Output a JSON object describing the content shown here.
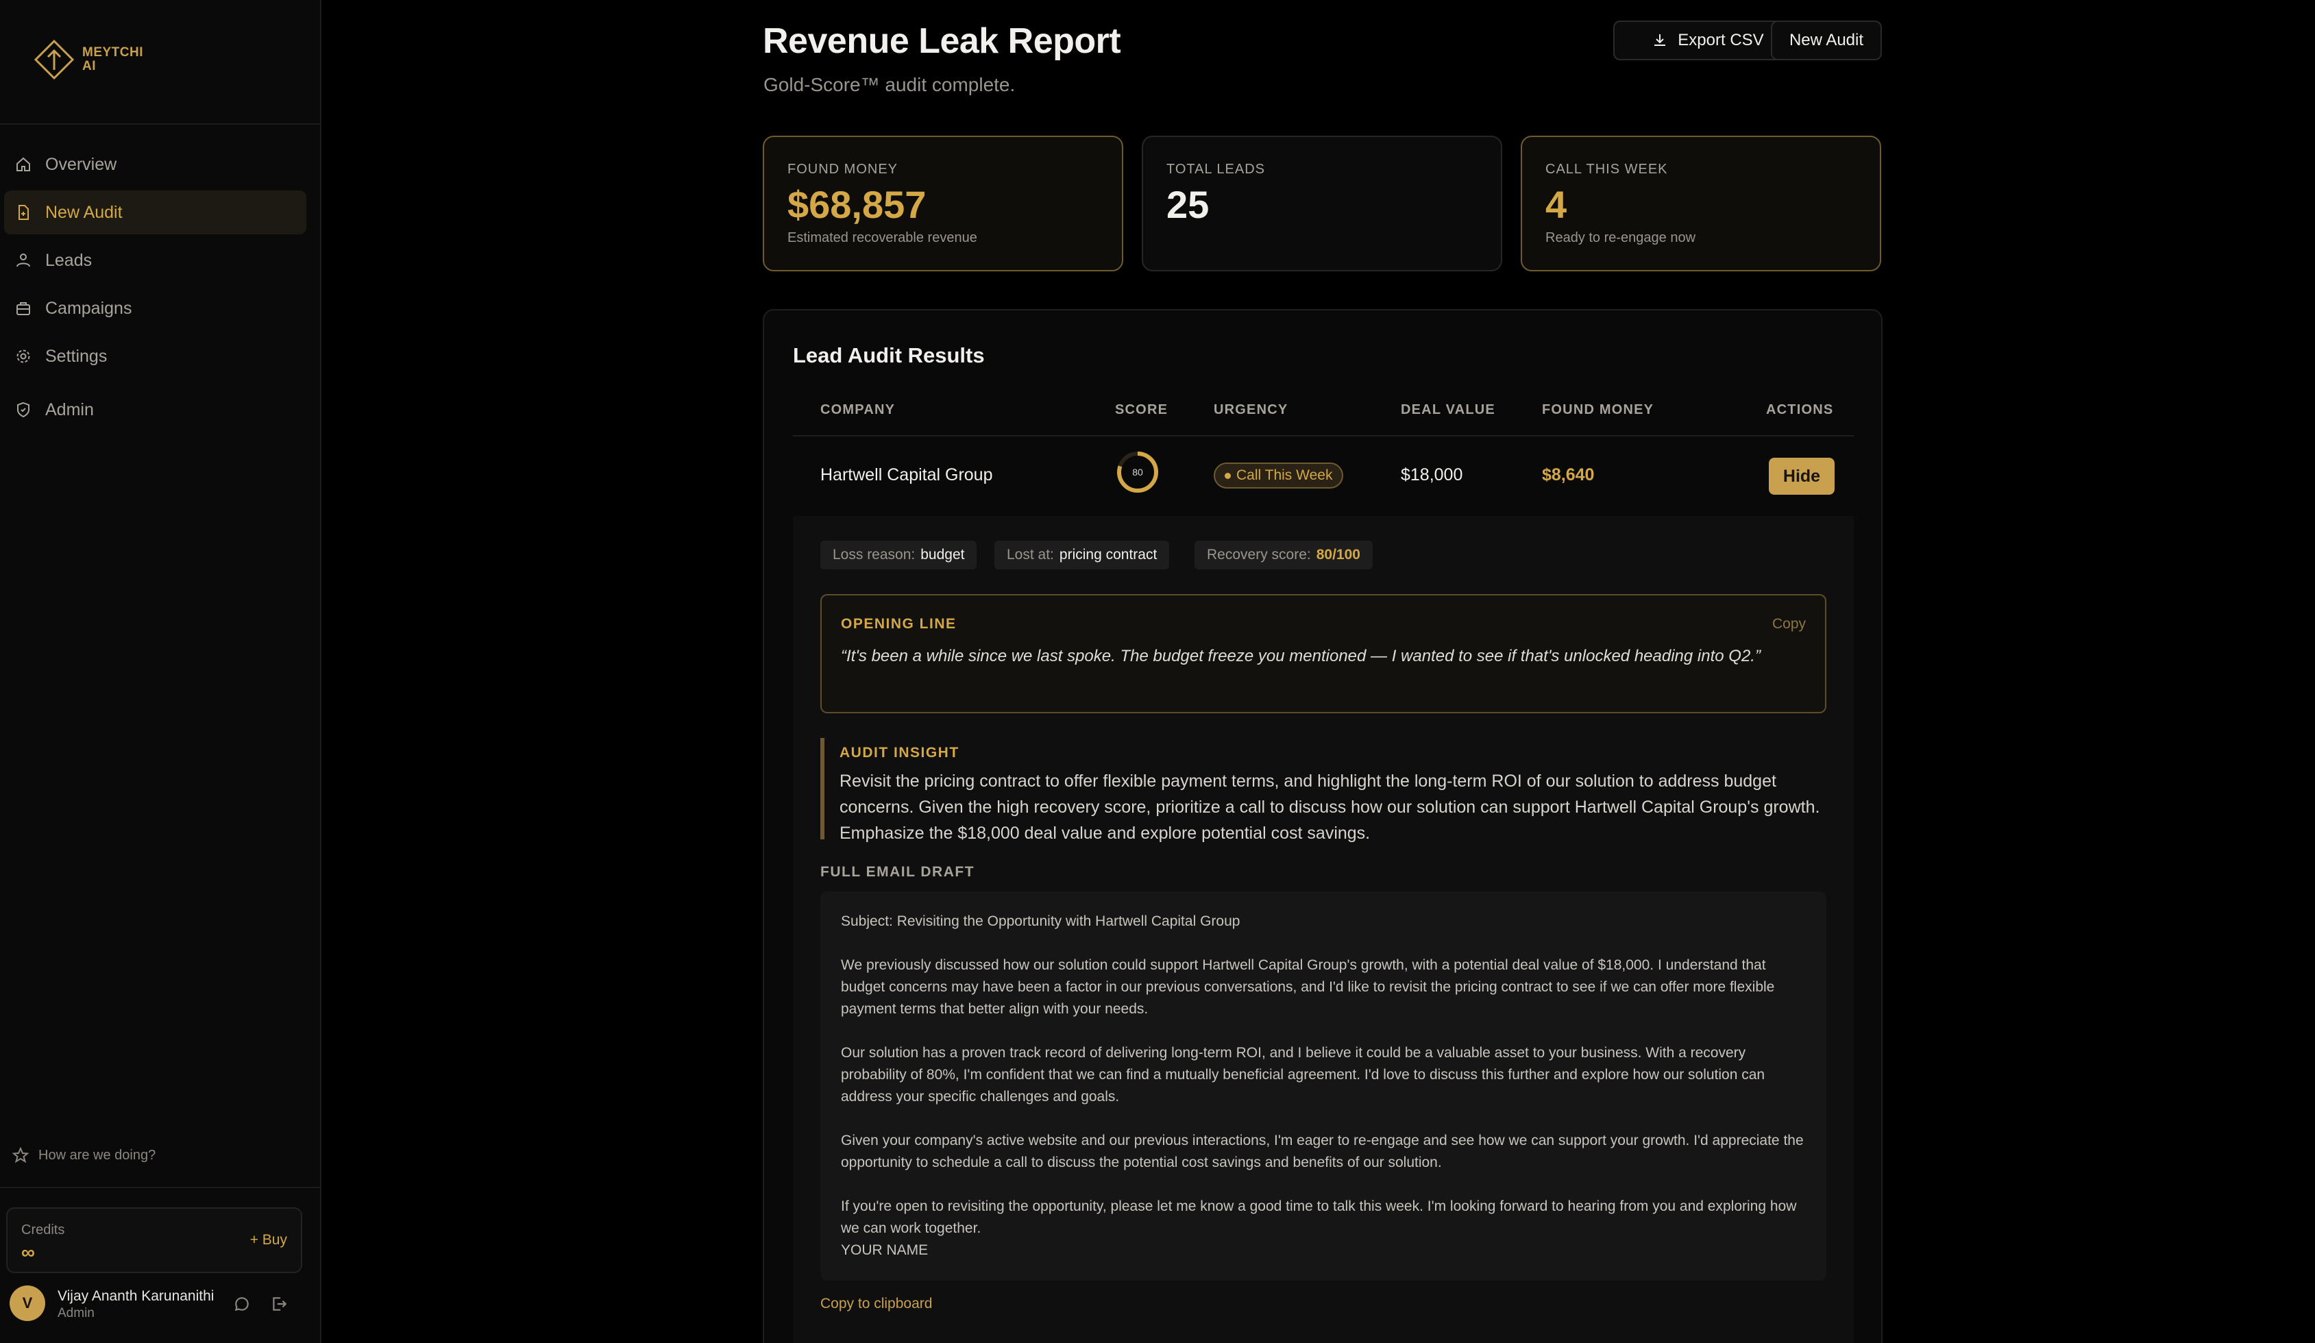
{
  "brand": {
    "name_line1": "MEYTCHI",
    "name_line2": "AI"
  },
  "nav": {
    "items": [
      {
        "label": "Overview",
        "icon": "home-icon"
      },
      {
        "label": "New Audit",
        "icon": "document-icon",
        "active": true
      },
      {
        "label": "Leads",
        "icon": "users-icon"
      },
      {
        "label": "Campaigns",
        "icon": "briefcase-icon"
      },
      {
        "label": "Settings",
        "icon": "gear-icon"
      },
      {
        "label": "Admin",
        "icon": "shield-icon"
      }
    ]
  },
  "sidebar_footer": {
    "feedback": "How are we doing?",
    "credits_label": "Credits",
    "credits_value": "∞",
    "buy_label": "+ Buy",
    "user_initial": "V",
    "user_name": "Vijay Ananth Karunanithi",
    "user_role": "Admin"
  },
  "header": {
    "title": "Revenue Leak Report",
    "subtitle": "Gold-Score™ audit complete.",
    "export_label": "Export CSV",
    "new_audit_label": "New Audit"
  },
  "stats": [
    {
      "label": "FOUND MONEY",
      "value": "$68,857",
      "sub": "Estimated recoverable revenue"
    },
    {
      "label": "TOTAL LEADS",
      "value": "25",
      "sub": ""
    },
    {
      "label": "CALL THIS WEEK",
      "value": "4",
      "sub": "Ready to re-engage now"
    }
  ],
  "results": {
    "title": "Lead Audit Results",
    "columns": [
      "COMPANY",
      "SCORE",
      "URGENCY",
      "DEAL VALUE",
      "FOUND MONEY",
      "ACTIONS"
    ],
    "rows": [
      {
        "company": "Hartwell Capital Group",
        "score": "80",
        "score_fraction": 0.8,
        "urgency": "Call This Week",
        "deal_value": "$18,000",
        "found_money": "$8,640",
        "action": "Hide"
      }
    ],
    "detail": {
      "loss_reason_label": "Loss reason:",
      "loss_reason": "budget",
      "lost_at_label": "Lost at:",
      "lost_at": "pricing contract",
      "recovery_label": "Recovery score:",
      "recovery": "80/100",
      "opening_label": "OPENING LINE",
      "copy_label": "Copy",
      "opening_text": "“It's been a while since we last spoke. The budget freeze you mentioned — I wanted to see if that's unlocked heading into Q2.”",
      "insight_label": "AUDIT INSIGHT",
      "insight_text": "Revisit the pricing contract to offer flexible payment terms, and highlight the long-term ROI of our solution to address budget concerns. Given the high recovery score, prioritize a call to discuss how our solution can support Hartwell Capital Group's growth. Emphasize the $18,000 deal value and explore potential cost savings.",
      "email_label": "FULL EMAIL DRAFT",
      "email": {
        "subject": "Subject: Revisiting the Opportunity with Hartwell Capital Group",
        "p1": "We previously discussed how our solution could support Hartwell Capital Group's growth, with a potential deal value of $18,000. I understand that budget concerns may have been a factor in our previous conversations, and I'd like to revisit the pricing contract to see if we can offer more flexible payment terms that better align with your needs.",
        "p2": "Our solution has a proven track record of delivering long-term ROI, and I believe it could be a valuable asset to your business. With a recovery probability of 80%, I'm confident that we can find a mutually beneficial agreement. I'd love to discuss this further and explore how our solution can address your specific challenges and goals.",
        "p3": "Given your company's active website and our previous interactions, I'm eager to re-engage and see how we can support your growth. I'd appreciate the opportunity to schedule a call to discuss the potential cost savings and benefits of our solution.",
        "p4": "If you're open to revisiting the opportunity, please let me know a good time to talk this week. I'm looking forward to hearing from you and exploring how we can work together.",
        "signature": "YOUR NAME"
      },
      "copy_clipboard_label": "Copy to clipboard"
    }
  },
  "colors": {
    "accent": "#d4a846",
    "background": "#000000",
    "panel": "#0b0b0b"
  }
}
